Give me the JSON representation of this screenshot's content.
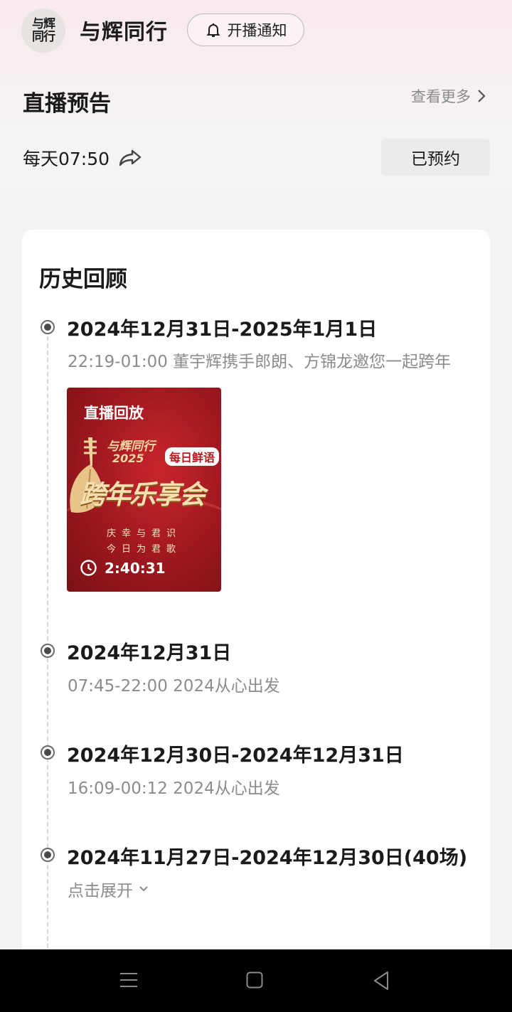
{
  "header": {
    "avatar_text": "与辉同行",
    "channel_name": "与辉同行",
    "notify_label": "开播通知",
    "notify_icon": "bell-icon"
  },
  "preview": {
    "title": "直播预告",
    "see_more": "查看更多",
    "schedule": "每天07:50",
    "share_icon": "share-icon",
    "reserved_label": "已预约"
  },
  "history": {
    "title": "历史回顾",
    "entries": [
      {
        "date": "2024年12月31日-2025年1月1日",
        "desc": "22:19-01:00 董宇辉携手郎朗、方锦龙邀您一起跨年",
        "replay": {
          "badge": "直播回放",
          "series": "与辉同行",
          "year": "2025",
          "tag": "每日鲜语",
          "poster_title": "跨年乐享会",
          "line1": "庆幸与君识",
          "line2": "今日为君歌",
          "duration": "2:40:31"
        }
      },
      {
        "date": "2024年12月31日",
        "desc": "07:45-22:00 2024从心出发"
      },
      {
        "date": "2024年12月30日-2024年12月31日",
        "desc": "16:09-00:12 2024从心出发"
      },
      {
        "date": "2024年11月27日-2024年12月30日(40场)",
        "expand": "点击展开"
      }
    ]
  },
  "colors": {
    "accent_text": "#1a1a1a",
    "secondary_text": "#8c8c8c",
    "poster_red": "#a31a20",
    "navbar": "#000000"
  }
}
